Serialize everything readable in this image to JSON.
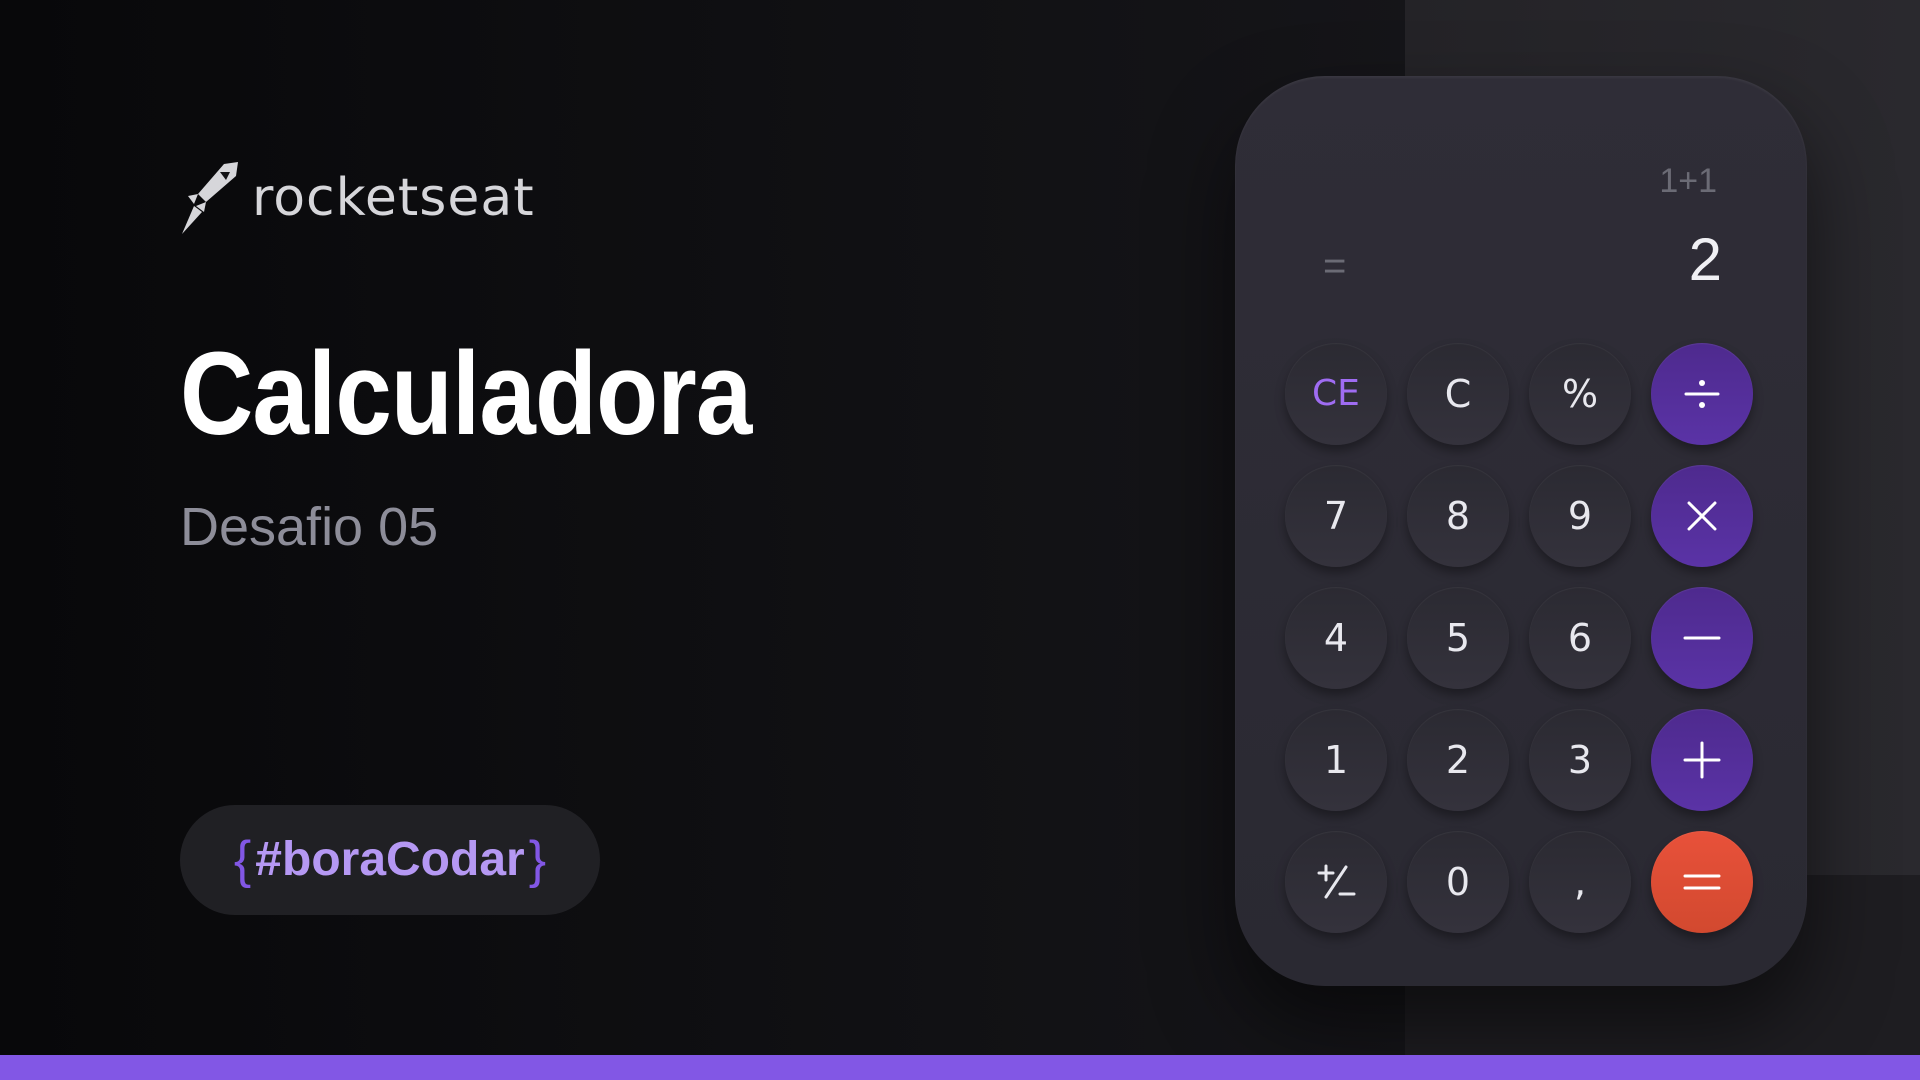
{
  "brand": {
    "logo_icon": "rocket-icon",
    "logo_text": "rocketseat"
  },
  "hero": {
    "title": "Calculadora",
    "subtitle": "Desafio 05"
  },
  "badge": {
    "open_brace": "{",
    "tag": "#boraCodar",
    "close_brace": "}"
  },
  "calculator": {
    "expression": "1+1",
    "equals_symbol": "=",
    "result": "2",
    "keys": {
      "ce": "CE",
      "c": "C",
      "percent": "%",
      "divide_icon": "divide-icon",
      "seven": "7",
      "eight": "8",
      "nine": "9",
      "multiply_icon": "multiply-icon",
      "four": "4",
      "five": "5",
      "six": "6",
      "minus_icon": "minus-icon",
      "one": "1",
      "two": "2",
      "three": "3",
      "plus_icon": "plus-icon",
      "plus_minus_icon": "plus-minus-icon",
      "zero": "0",
      "comma": ",",
      "equals_icon": "equals-icon"
    }
  },
  "colors": {
    "accent": "#8257e5",
    "operator_key": "#5a33a6",
    "equals_key": "#e8513a",
    "calculator_body": "#2f2d37"
  }
}
